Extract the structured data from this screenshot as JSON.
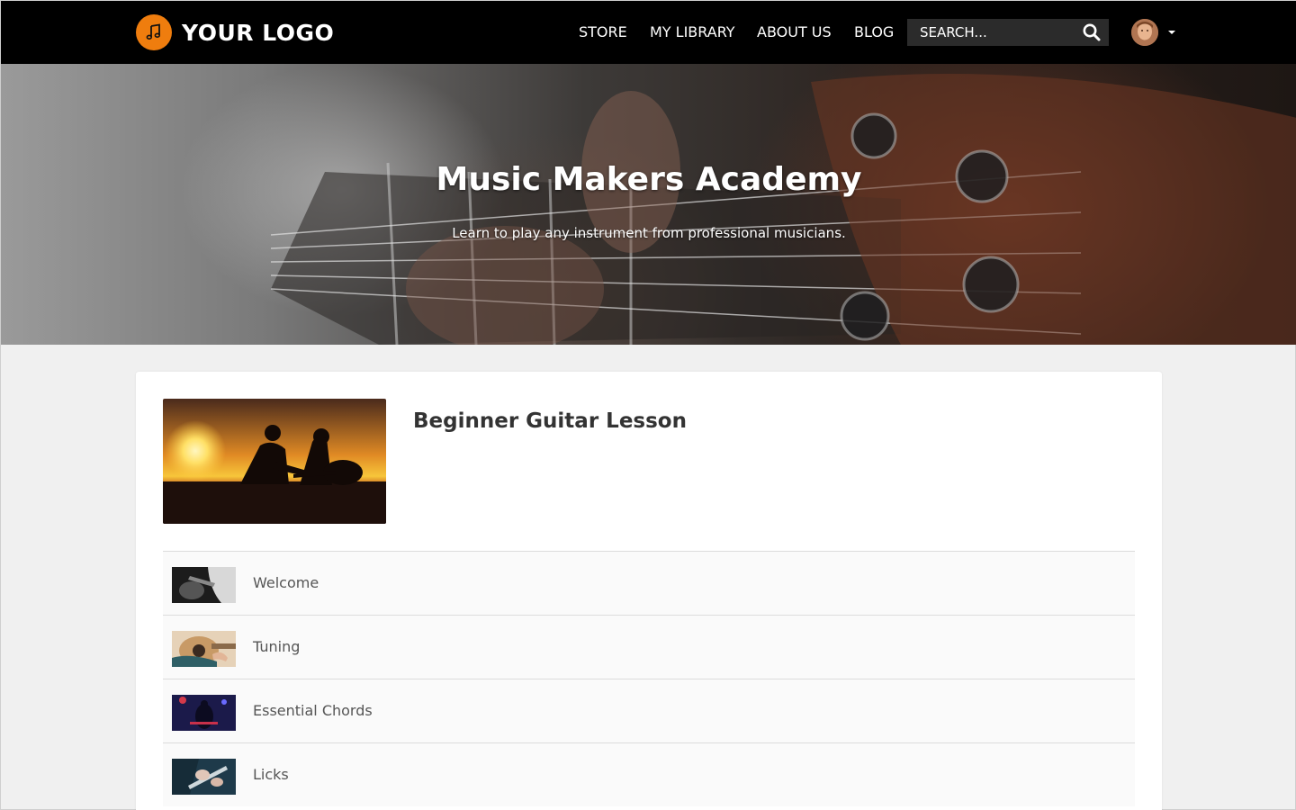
{
  "header": {
    "logo_text": "YOUR LOGO",
    "logo_icon": "music-note-icon",
    "nav": [
      {
        "label": "STORE"
      },
      {
        "label": "MY LIBRARY"
      },
      {
        "label": "ABOUT US"
      },
      {
        "label": "BLOG"
      }
    ],
    "search": {
      "placeholder": "SEARCH...",
      "value": "",
      "icon": "search-icon"
    },
    "user": {
      "avatar_icon": "user-avatar",
      "menu_icon": "caret-down-icon"
    }
  },
  "hero": {
    "title": "Music Makers Academy",
    "subtitle": "Learn to play any instrument from professional musicians."
  },
  "course": {
    "title": "Beginner Guitar Lesson",
    "lessons": [
      {
        "label": "Welcome"
      },
      {
        "label": "Tuning"
      },
      {
        "label": "Essential Chords"
      },
      {
        "label": "Licks"
      }
    ]
  },
  "colors": {
    "brand_orange": "#ef7d0e",
    "nav_background": "#000000",
    "page_background": "#f0f0f0"
  }
}
